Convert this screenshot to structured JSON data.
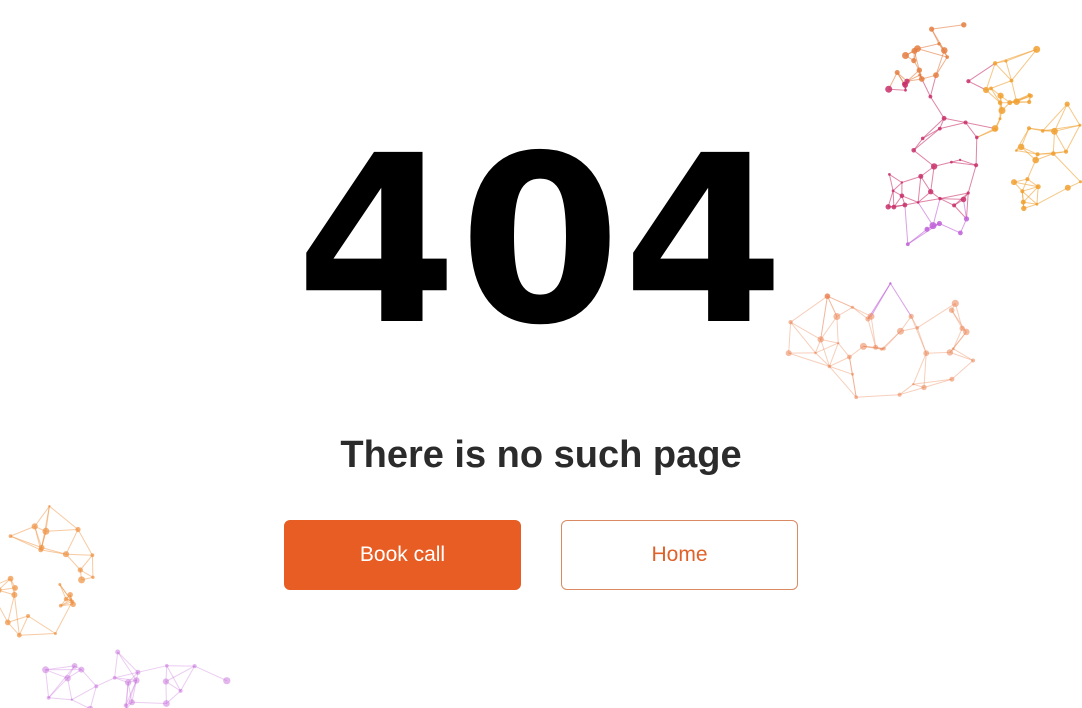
{
  "error": {
    "code": "404",
    "message": "There is no such page"
  },
  "actions": {
    "book_call_label": "Book call",
    "home_label": "Home"
  },
  "colors": {
    "accent": "#e85d24",
    "text": "#2b2b2b",
    "code_text": "#000000",
    "mesh_orange": "#f0a030",
    "mesh_magenta": "#c8306a",
    "mesh_purple": "#c060d8"
  }
}
